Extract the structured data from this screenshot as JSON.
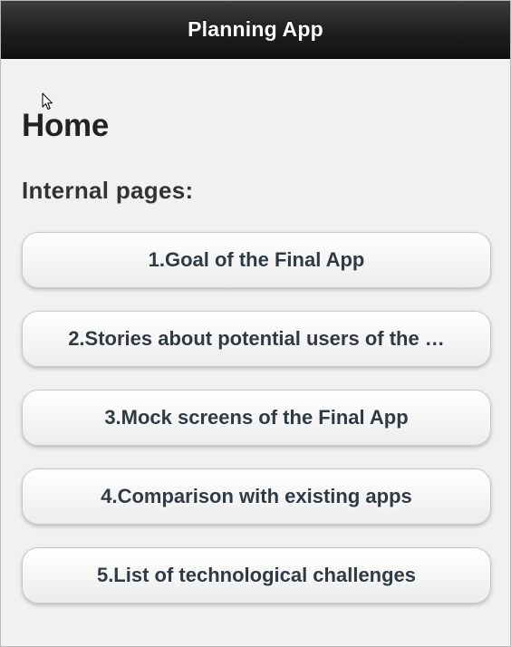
{
  "header": {
    "title": "Planning App"
  },
  "main": {
    "page_title": "Home",
    "section_title": "Internal pages:",
    "links": [
      {
        "label": "1.Goal of the Final App"
      },
      {
        "label": "2.Stories about potential users of the …"
      },
      {
        "label": "3.Mock screens of the Final App"
      },
      {
        "label": "4.Comparison with existing apps"
      },
      {
        "label": "5.List of technological challenges"
      }
    ]
  },
  "colors": {
    "header_bg": "#1f1f1f",
    "body_bg": "#f1f1f1",
    "button_text": "#2f3a45"
  },
  "icons": {
    "cursor": "mouse-pointer-icon"
  }
}
